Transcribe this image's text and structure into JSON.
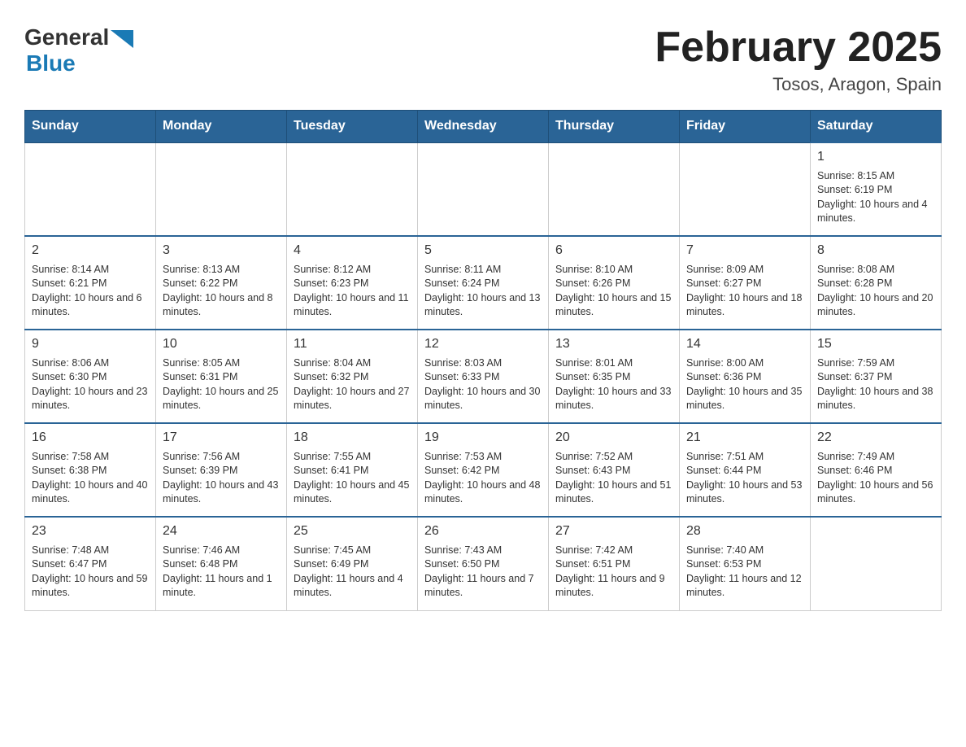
{
  "logo": {
    "text_general": "General",
    "text_blue": "Blue"
  },
  "header": {
    "title": "February 2025",
    "subtitle": "Tosos, Aragon, Spain"
  },
  "weekdays": [
    "Sunday",
    "Monday",
    "Tuesday",
    "Wednesday",
    "Thursday",
    "Friday",
    "Saturday"
  ],
  "weeks": [
    [
      {
        "day": "",
        "info": ""
      },
      {
        "day": "",
        "info": ""
      },
      {
        "day": "",
        "info": ""
      },
      {
        "day": "",
        "info": ""
      },
      {
        "day": "",
        "info": ""
      },
      {
        "day": "",
        "info": ""
      },
      {
        "day": "1",
        "info": "Sunrise: 8:15 AM\nSunset: 6:19 PM\nDaylight: 10 hours and 4 minutes."
      }
    ],
    [
      {
        "day": "2",
        "info": "Sunrise: 8:14 AM\nSunset: 6:21 PM\nDaylight: 10 hours and 6 minutes."
      },
      {
        "day": "3",
        "info": "Sunrise: 8:13 AM\nSunset: 6:22 PM\nDaylight: 10 hours and 8 minutes."
      },
      {
        "day": "4",
        "info": "Sunrise: 8:12 AM\nSunset: 6:23 PM\nDaylight: 10 hours and 11 minutes."
      },
      {
        "day": "5",
        "info": "Sunrise: 8:11 AM\nSunset: 6:24 PM\nDaylight: 10 hours and 13 minutes."
      },
      {
        "day": "6",
        "info": "Sunrise: 8:10 AM\nSunset: 6:26 PM\nDaylight: 10 hours and 15 minutes."
      },
      {
        "day": "7",
        "info": "Sunrise: 8:09 AM\nSunset: 6:27 PM\nDaylight: 10 hours and 18 minutes."
      },
      {
        "day": "8",
        "info": "Sunrise: 8:08 AM\nSunset: 6:28 PM\nDaylight: 10 hours and 20 minutes."
      }
    ],
    [
      {
        "day": "9",
        "info": "Sunrise: 8:06 AM\nSunset: 6:30 PM\nDaylight: 10 hours and 23 minutes."
      },
      {
        "day": "10",
        "info": "Sunrise: 8:05 AM\nSunset: 6:31 PM\nDaylight: 10 hours and 25 minutes."
      },
      {
        "day": "11",
        "info": "Sunrise: 8:04 AM\nSunset: 6:32 PM\nDaylight: 10 hours and 27 minutes."
      },
      {
        "day": "12",
        "info": "Sunrise: 8:03 AM\nSunset: 6:33 PM\nDaylight: 10 hours and 30 minutes."
      },
      {
        "day": "13",
        "info": "Sunrise: 8:01 AM\nSunset: 6:35 PM\nDaylight: 10 hours and 33 minutes."
      },
      {
        "day": "14",
        "info": "Sunrise: 8:00 AM\nSunset: 6:36 PM\nDaylight: 10 hours and 35 minutes."
      },
      {
        "day": "15",
        "info": "Sunrise: 7:59 AM\nSunset: 6:37 PM\nDaylight: 10 hours and 38 minutes."
      }
    ],
    [
      {
        "day": "16",
        "info": "Sunrise: 7:58 AM\nSunset: 6:38 PM\nDaylight: 10 hours and 40 minutes."
      },
      {
        "day": "17",
        "info": "Sunrise: 7:56 AM\nSunset: 6:39 PM\nDaylight: 10 hours and 43 minutes."
      },
      {
        "day": "18",
        "info": "Sunrise: 7:55 AM\nSunset: 6:41 PM\nDaylight: 10 hours and 45 minutes."
      },
      {
        "day": "19",
        "info": "Sunrise: 7:53 AM\nSunset: 6:42 PM\nDaylight: 10 hours and 48 minutes."
      },
      {
        "day": "20",
        "info": "Sunrise: 7:52 AM\nSunset: 6:43 PM\nDaylight: 10 hours and 51 minutes."
      },
      {
        "day": "21",
        "info": "Sunrise: 7:51 AM\nSunset: 6:44 PM\nDaylight: 10 hours and 53 minutes."
      },
      {
        "day": "22",
        "info": "Sunrise: 7:49 AM\nSunset: 6:46 PM\nDaylight: 10 hours and 56 minutes."
      }
    ],
    [
      {
        "day": "23",
        "info": "Sunrise: 7:48 AM\nSunset: 6:47 PM\nDaylight: 10 hours and 59 minutes."
      },
      {
        "day": "24",
        "info": "Sunrise: 7:46 AM\nSunset: 6:48 PM\nDaylight: 11 hours and 1 minute."
      },
      {
        "day": "25",
        "info": "Sunrise: 7:45 AM\nSunset: 6:49 PM\nDaylight: 11 hours and 4 minutes."
      },
      {
        "day": "26",
        "info": "Sunrise: 7:43 AM\nSunset: 6:50 PM\nDaylight: 11 hours and 7 minutes."
      },
      {
        "day": "27",
        "info": "Sunrise: 7:42 AM\nSunset: 6:51 PM\nDaylight: 11 hours and 9 minutes."
      },
      {
        "day": "28",
        "info": "Sunrise: 7:40 AM\nSunset: 6:53 PM\nDaylight: 11 hours and 12 minutes."
      },
      {
        "day": "",
        "info": ""
      }
    ]
  ]
}
